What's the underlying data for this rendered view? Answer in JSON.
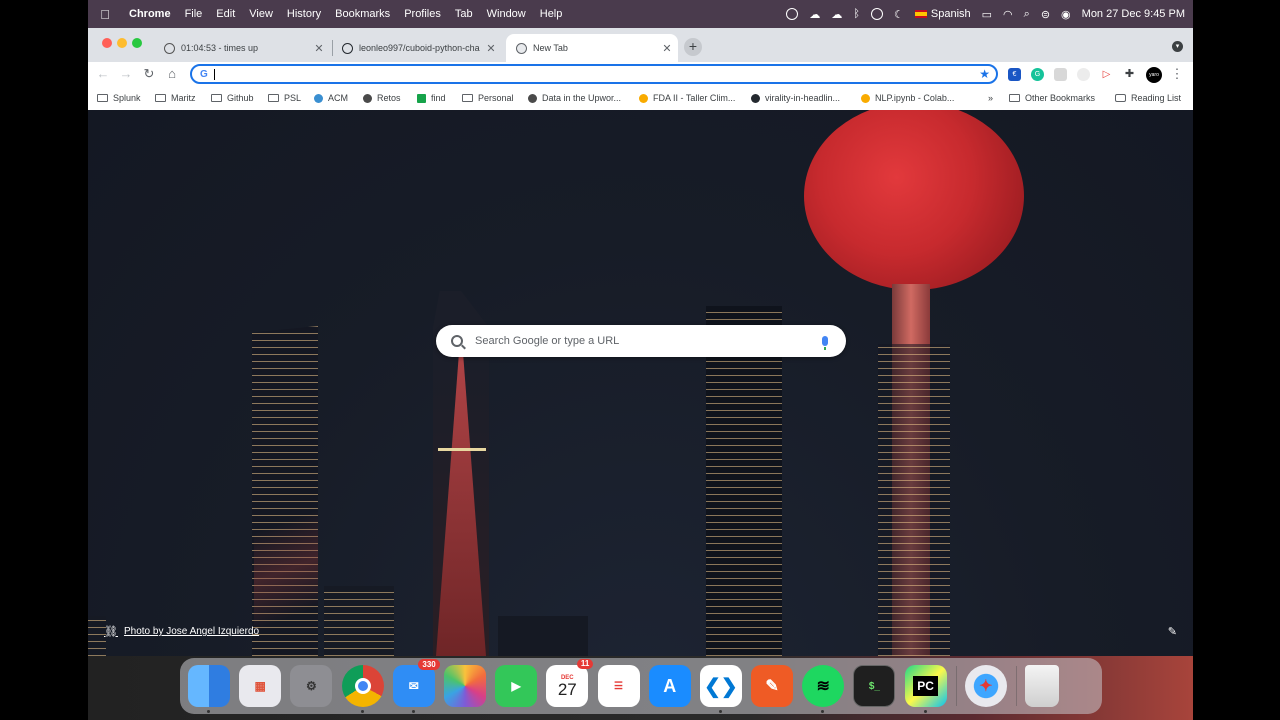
{
  "menubar": {
    "app_name": "Chrome",
    "items": [
      "File",
      "Edit",
      "View",
      "History",
      "Bookmarks",
      "Profiles",
      "Tab",
      "Window",
      "Help"
    ],
    "input_source": "Spanish",
    "datetime": "Mon 27 Dec  9:45 PM"
  },
  "tabs": [
    {
      "title": "01:04:53 - times up",
      "icon": "timer-icon",
      "active": false
    },
    {
      "title": "leonleo997/cuboid-python-cha",
      "icon": "github-icon",
      "active": false
    },
    {
      "title": "New Tab",
      "icon": "chrome-icon",
      "active": true
    }
  ],
  "omnibox": {
    "value": "",
    "icon": "google-g-icon"
  },
  "bookmarks": [
    {
      "label": "Splunk",
      "icon": "folder-icon"
    },
    {
      "label": "Maritz",
      "icon": "folder-icon"
    },
    {
      "label": "Github",
      "icon": "folder-icon"
    },
    {
      "label": "PSL",
      "icon": "folder-icon"
    },
    {
      "label": "ACM",
      "icon": "acm-icon"
    },
    {
      "label": "Retos",
      "icon": "globe-icon"
    },
    {
      "label": "find",
      "icon": "find-icon"
    },
    {
      "label": "Personal",
      "icon": "folder-icon"
    },
    {
      "label": "Data in the Upwor...",
      "icon": "globe-icon"
    },
    {
      "label": "FDA II - Taller Clim...",
      "icon": "colab-icon"
    },
    {
      "label": "virality-in-headlin...",
      "icon": "github-icon"
    },
    {
      "label": "NLP.ipynb - Colab...",
      "icon": "colab-icon"
    }
  ],
  "bookmarks_overflow": "»",
  "other_bookmarks": "Other Bookmarks",
  "reading_list": "Reading List",
  "ntp": {
    "search_placeholder": "Search Google or type a URL",
    "photo_credit": "Photo by Jose Angel Izquierdo"
  },
  "extensions": [
    {
      "name": "euro-extension-icon",
      "color": "#1a56c4",
      "label": "€"
    },
    {
      "name": "grammarly-icon",
      "color": "#15c39a",
      "label": "G"
    },
    {
      "name": "extension-grey-icon",
      "color": "#d0d0d0",
      "label": ""
    },
    {
      "name": "extension-light-icon",
      "color": "#e8e8e8",
      "label": ""
    },
    {
      "name": "extension-red-icon",
      "color": "#e53935",
      "label": ""
    },
    {
      "name": "puzzle-icon",
      "color": "#5f6368",
      "label": ""
    },
    {
      "name": "profile-avatar-icon",
      "color": "#000000",
      "label": "yaro"
    }
  ],
  "dock": [
    {
      "name": "finder-icon",
      "color": "#3b8beb",
      "label": ""
    },
    {
      "name": "launchpad-icon",
      "color": "#e9e9ee",
      "label": ""
    },
    {
      "name": "system-preferences-icon",
      "color": "#8e8e93",
      "label": ""
    },
    {
      "name": "chrome-icon",
      "color": "#f1f1f1",
      "label": ""
    },
    {
      "name": "mail-icon",
      "color": "#2f8df5",
      "label": "",
      "badge": "330"
    },
    {
      "name": "photos-icon",
      "color": "#f5f5f5",
      "label": ""
    },
    {
      "name": "facetime-icon",
      "color": "#33c759",
      "label": ""
    },
    {
      "name": "calendar-icon",
      "color": "#ffffff",
      "label": "27",
      "badge": "11",
      "sublabel": "DEC"
    },
    {
      "name": "reminders-icon",
      "color": "#ffffff",
      "label": ""
    },
    {
      "name": "app-store-icon",
      "color": "#1a8cff",
      "label": ""
    },
    {
      "name": "vscode-icon",
      "color": "#ffffff",
      "label": ""
    },
    {
      "name": "postman-icon",
      "color": "#ef5b25",
      "label": ""
    },
    {
      "name": "spotify-icon",
      "color": "#1ed760",
      "label": ""
    },
    {
      "name": "terminal-icon",
      "color": "#1f1f1f",
      "label": "$_"
    },
    {
      "name": "pycharm-icon",
      "color": "#21d789",
      "label": "PC"
    },
    {
      "name": "safari-icon",
      "color": "#f2f2f2",
      "label": ""
    },
    {
      "name": "trash-icon",
      "color": "#dcdcdc",
      "label": ""
    }
  ],
  "colors": {
    "accent": "#1a73e8",
    "menubar": "#4a3b4d",
    "moon": "#c72a2e"
  }
}
